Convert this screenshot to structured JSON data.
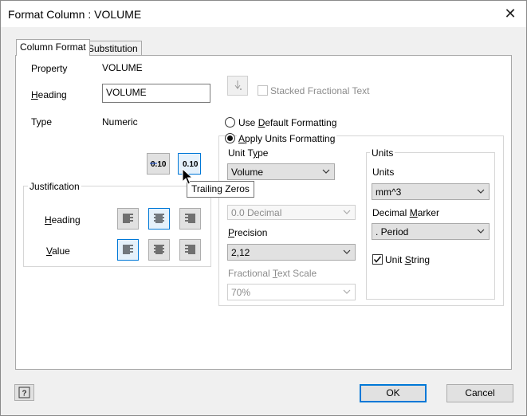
{
  "window": {
    "title": "Format Column : VOLUME",
    "close_glyph": "✕"
  },
  "tabs": [
    {
      "label": "Column Format",
      "active": true
    },
    {
      "label": "Substitution",
      "active": false
    }
  ],
  "property": {
    "label": "Property",
    "value": "VOLUME"
  },
  "heading": {
    "label_underlined": "H",
    "label_rest": "eading",
    "value": "VOLUME"
  },
  "type": {
    "label": "Type",
    "value": "Numeric"
  },
  "stacked_fractional_text": {
    "label": "Stacked Fractional Text",
    "checked": false,
    "enabled": false
  },
  "zero_buttons": {
    "leading_text": "0.10",
    "trailing_text": "0.10"
  },
  "tooltip": "Trailing Zeros",
  "justification": {
    "title": "Justification",
    "heading_label_underlined": "H",
    "heading_label_rest": "eading",
    "value_label_underlined": "V",
    "value_label_rest": "alue"
  },
  "formatting": {
    "default_label_pre": "Use ",
    "default_label_underlined": "D",
    "default_label_rest": "efault Formatting",
    "apply_label_pre": "",
    "apply_label_underlined": "A",
    "apply_label_rest": "pply Units Formatting",
    "selected": "apply"
  },
  "unit_type": {
    "label_pre": "Unit T",
    "label_underlined": "y",
    "label_rest": "pe",
    "value": "Volume"
  },
  "format": {
    "value": "0.0 Decimal"
  },
  "precision": {
    "label_underlined": "P",
    "label_rest": "recision",
    "value": "2,12"
  },
  "fractional_text_scale": {
    "label_pre": "Fractional ",
    "label_underlined": "T",
    "label_rest": "ext Scale",
    "value": "70%"
  },
  "units_group": {
    "title": "Units",
    "units_label": "Units",
    "units_value": "mm^3",
    "decimal_marker_label_pre": "Decimal ",
    "decimal_marker_label_underlined": "M",
    "decimal_marker_label_rest": "arker",
    "decimal_marker_value": ". Period",
    "unit_string_label_pre": "Unit ",
    "unit_string_label_underlined": "S",
    "unit_string_label_rest": "tring",
    "unit_string_checked": true
  },
  "buttons": {
    "ok": "OK",
    "cancel": "Cancel",
    "help_glyph": "?"
  },
  "colors": {
    "accent": "#0078d7",
    "selected_bg": "#e5f1fb",
    "tooltip_border": "#767676"
  }
}
